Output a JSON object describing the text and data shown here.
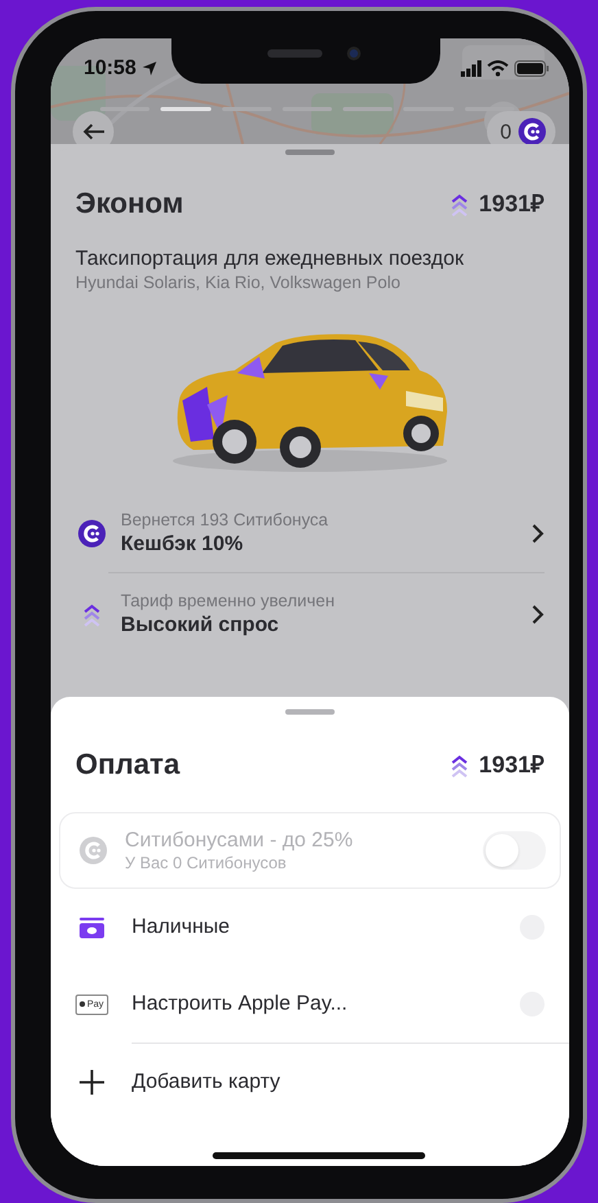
{
  "status_bar": {
    "time": "10:58"
  },
  "story_progress": [
    {
      "selected": false
    },
    {
      "selected": true
    },
    {
      "selected": false
    },
    {
      "selected": false
    },
    {
      "selected": false
    },
    {
      "selected": false
    },
    {
      "selected": false
    }
  ],
  "top_bar": {
    "bonus_balance": "0"
  },
  "tariff": {
    "title": "Эконом",
    "price": "1931₽",
    "surge": true,
    "description": "Таксипортация для ежедневных поездок",
    "cars": "Hyundai Solaris, Kia Rio, Volkswagen Polo",
    "rows": [
      {
        "kind": "cashback",
        "caption": "Вернется 193 Ситибонуса",
        "title": "Кешбэк 10%"
      },
      {
        "kind": "surge",
        "caption": "Тариф временно увеличен",
        "title": "Высокий спрос"
      }
    ]
  },
  "payment": {
    "title": "Оплата",
    "price": "1931₽",
    "surge": true,
    "bonus_option": {
      "title": "Ситибонусами - до 25%",
      "subtitle": "У Вас 0 Ситибонусов",
      "disabled": true,
      "on": false
    },
    "methods": [
      {
        "kind": "cash",
        "label": "Наличные",
        "selected": false
      },
      {
        "kind": "applepay",
        "label": "Настроить Apple Pay...",
        "badge": "Pay",
        "selected": false
      },
      {
        "kind": "add",
        "label": "Добавить карту"
      }
    ]
  }
}
